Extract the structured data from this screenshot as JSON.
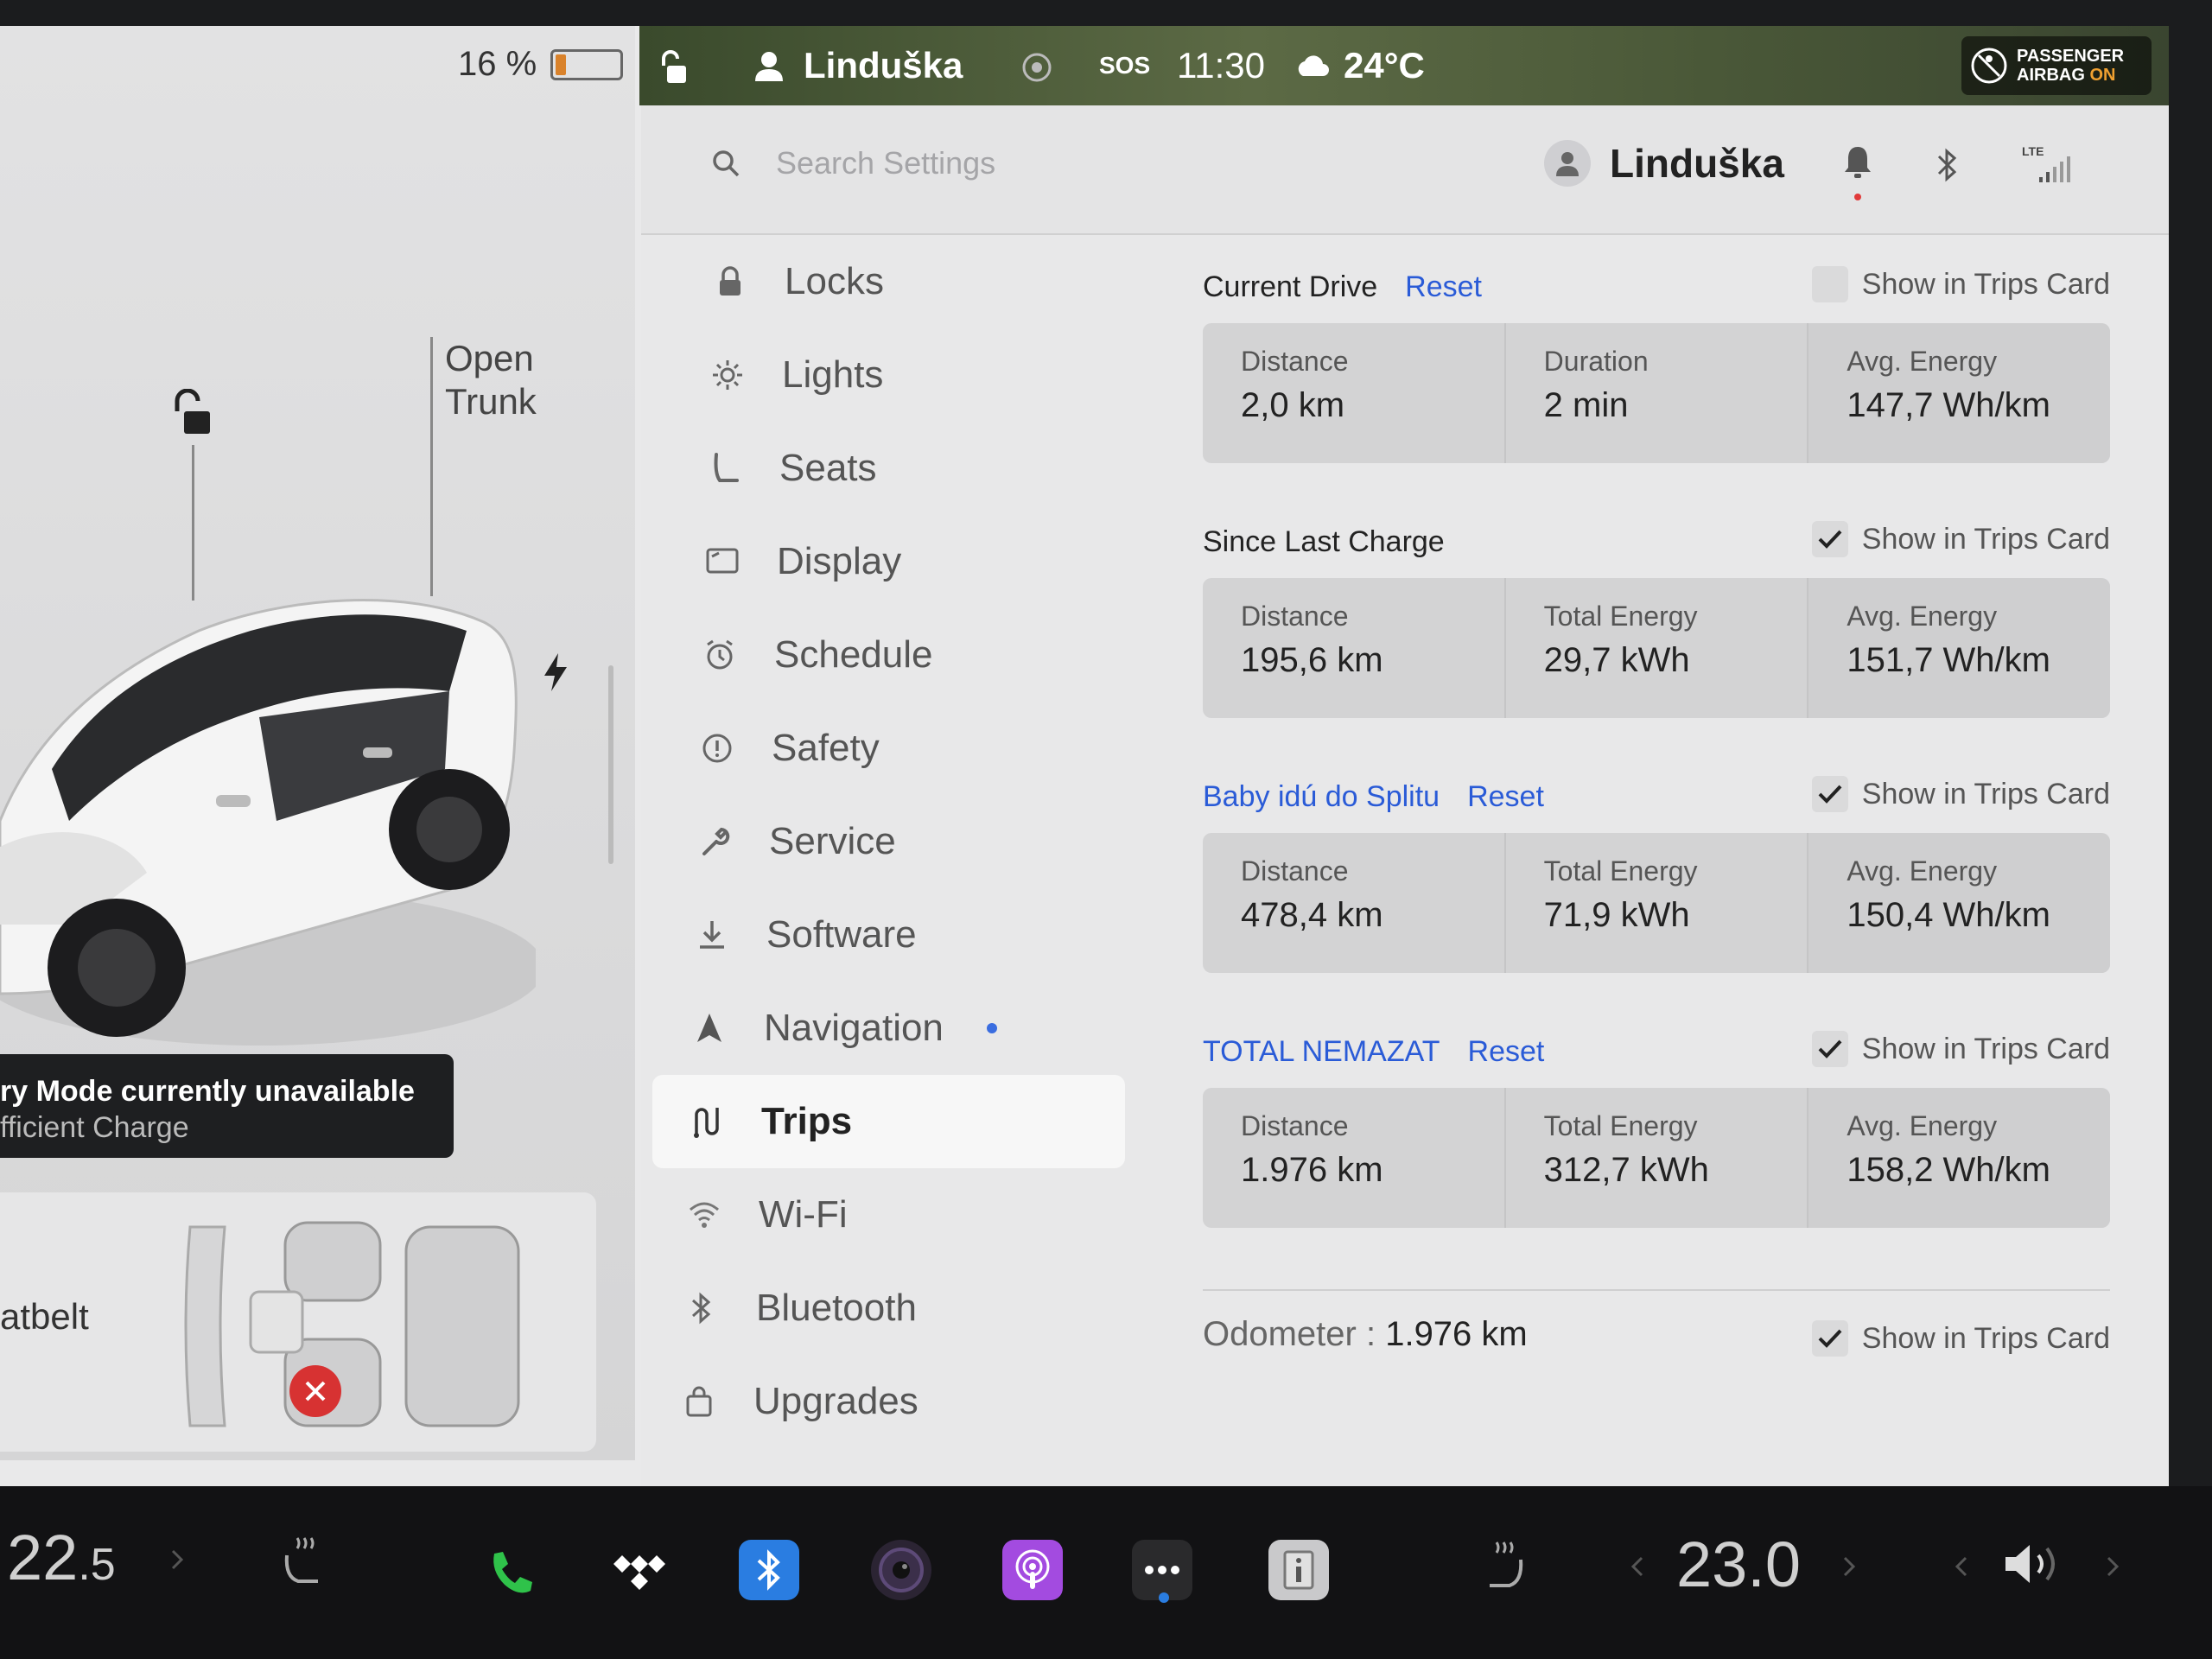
{
  "status_bar": {
    "battery_percent": "16 %",
    "battery_level": 0.16,
    "profile_name": "Linduška",
    "sos": "SOS",
    "time": "11:30",
    "temperature": "24°C",
    "airbag_line1": "PASSENGER",
    "airbag_line2": "AIRBAG",
    "airbag_state": "ON"
  },
  "car_panel": {
    "open_trunk_line1": "Open",
    "open_trunk_line2": "Trunk",
    "notice_line1": "ry Mode currently unavailable",
    "notice_line2": "fficient Charge",
    "seatbelt_label": "atbelt"
  },
  "header": {
    "search_placeholder": "Search Settings",
    "profile_name": "Linduška",
    "signal_label": "LTE"
  },
  "nav": {
    "items": [
      {
        "label": "Locks",
        "icon": "lock-icon"
      },
      {
        "label": "Lights",
        "icon": "sun-icon"
      },
      {
        "label": "Seats",
        "icon": "seat-icon"
      },
      {
        "label": "Display",
        "icon": "display-icon"
      },
      {
        "label": "Schedule",
        "icon": "alarm-clock-icon"
      },
      {
        "label": "Safety",
        "icon": "alert-circle-icon"
      },
      {
        "label": "Service",
        "icon": "wrench-icon"
      },
      {
        "label": "Software",
        "icon": "download-icon"
      },
      {
        "label": "Navigation",
        "icon": "navigation-arrow-icon",
        "has_dot": true
      },
      {
        "label": "Trips",
        "icon": "trips-icon",
        "active": true
      },
      {
        "label": "Wi-Fi",
        "icon": "wifi-icon"
      },
      {
        "label": "Bluetooth",
        "icon": "bluetooth-icon"
      },
      {
        "label": "Upgrades",
        "icon": "shopping-bag-icon"
      }
    ]
  },
  "trips": {
    "show_label": "Show in Trips Card",
    "reset_label": "Reset",
    "blocks": [
      {
        "title": "Current Drive",
        "title_blue": false,
        "has_reset": true,
        "checked": false,
        "stats": [
          {
            "label": "Distance",
            "value": "2,0 km"
          },
          {
            "label": "Duration",
            "value": "2 min"
          },
          {
            "label": "Avg. Energy",
            "value": "147,7 Wh/km"
          }
        ]
      },
      {
        "title": "Since Last Charge",
        "title_blue": false,
        "has_reset": false,
        "checked": true,
        "stats": [
          {
            "label": "Distance",
            "value": "195,6 km"
          },
          {
            "label": "Total Energy",
            "value": "29,7 kWh"
          },
          {
            "label": "Avg. Energy",
            "value": "151,7 Wh/km"
          }
        ]
      },
      {
        "title": "Baby idú do Splitu",
        "title_blue": true,
        "has_reset": true,
        "checked": true,
        "stats": [
          {
            "label": "Distance",
            "value": "478,4 km"
          },
          {
            "label": "Total Energy",
            "value": "71,9 kWh"
          },
          {
            "label": "Avg. Energy",
            "value": "150,4 Wh/km"
          }
        ]
      },
      {
        "title": "TOTAL NEMAZAT",
        "title_blue": true,
        "has_reset": true,
        "checked": true,
        "stats": [
          {
            "label": "Distance",
            "value": "1.976 km"
          },
          {
            "label": "Total Energy",
            "value": "312,7 kWh"
          },
          {
            "label": "Avg. Energy",
            "value": "158,2 Wh/km"
          }
        ]
      }
    ],
    "odometer_label": "Odometer :",
    "odometer_value": "1.976 km",
    "odometer_checked": true
  },
  "dock": {
    "driver_temp_int": "22",
    "driver_temp_dec": ".5",
    "passenger_temp": "23.0",
    "apps": [
      "phone-icon",
      "tidal-icon",
      "bluetooth-icon",
      "camera-icon",
      "podcasts-icon",
      "more-icon",
      "manual-icon"
    ]
  },
  "colors": {
    "accent_blue": "#2a5bd7",
    "battery_orange": "#d9822b",
    "airbag_on": "#f0a030",
    "alert_red": "#e13a3a"
  }
}
